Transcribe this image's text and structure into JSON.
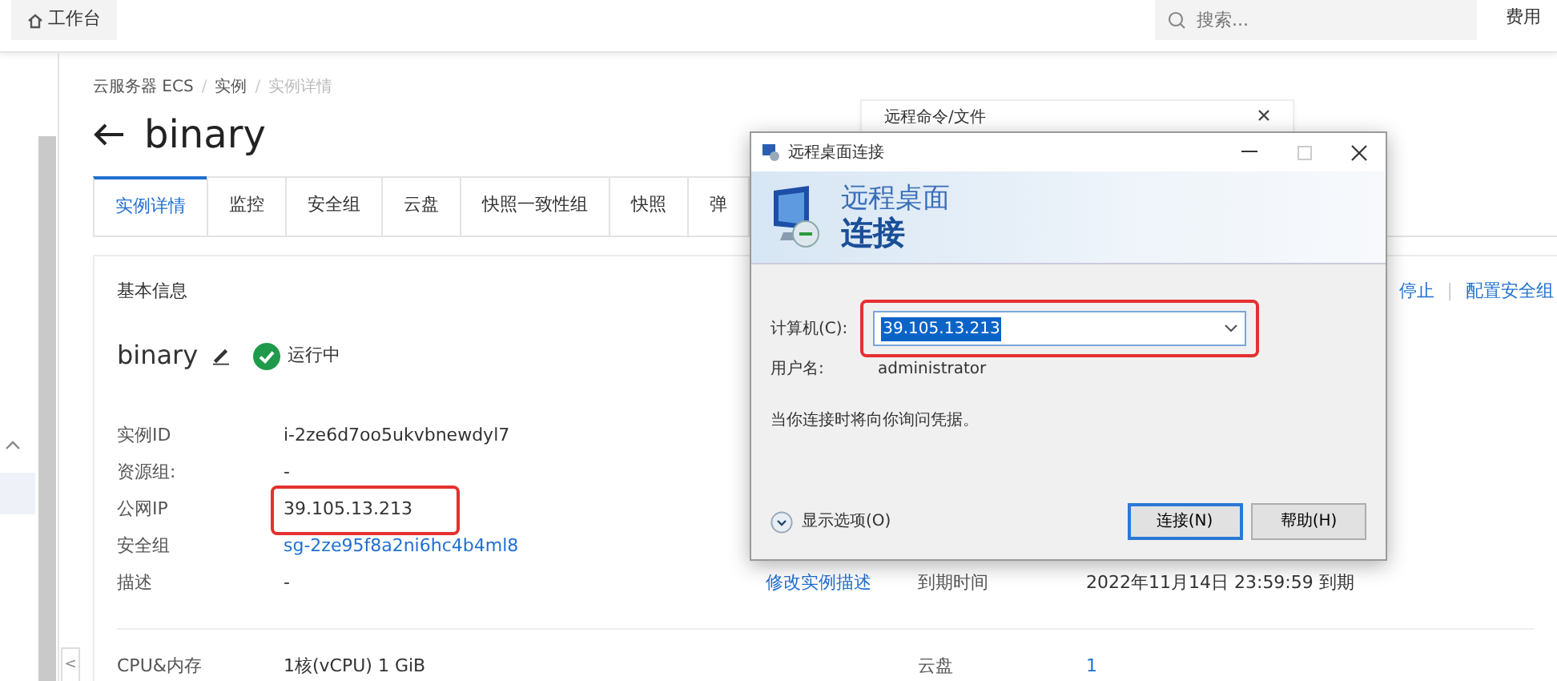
{
  "topbar": {
    "home": "工作台",
    "search": {
      "placeholder": "搜索..."
    },
    "right_link": "费用"
  },
  "breadcrumb": [
    "云服务器 ECS",
    "实例",
    "实例详情"
  ],
  "breadcrumb_separator": "/",
  "collapse_button": "<",
  "page_title": "binary",
  "tabs": [
    {
      "label": "实例详情",
      "selected": true
    },
    {
      "label": "监控",
      "selected": false
    },
    {
      "label": "安全组",
      "selected": false
    },
    {
      "label": "云盘",
      "selected": false
    },
    {
      "label": "快照一致性组",
      "selected": false
    },
    {
      "label": "快照",
      "selected": false
    },
    {
      "label": "弹",
      "selected": false
    }
  ],
  "basic_info": {
    "heading": "基本信息",
    "actions": [
      "停止",
      "配置安全组"
    ],
    "actions_separator": "|",
    "name": "binary",
    "status": "运行中",
    "rows": [
      {
        "label": "实例ID",
        "value": "i-2ze6d7oo5ukvbnewdyl7",
        "link": false,
        "highlighted": false
      },
      {
        "label": "资源组:",
        "value": "-",
        "link": false,
        "highlighted": false
      },
      {
        "label": "公网IP",
        "value": "39.105.13.213",
        "link": false,
        "highlighted": true
      },
      {
        "label": "安全组",
        "value": "sg-2ze95f8a2ni6hc4b4ml8",
        "link": true,
        "highlighted": false
      },
      {
        "label": "描述",
        "value": "-",
        "link": false,
        "highlighted": false,
        "action": "修改实例描述",
        "label_2": "到期时间",
        "value_2": "2022年11月14日 23:59:59 到期"
      }
    ],
    "next_row": {
      "label": "CPU&内存",
      "value": "1核(vCPU) 1 GiB",
      "label_2": "云盘",
      "value_2": "1"
    }
  },
  "side_panel": {
    "title": "远程命令/文件"
  },
  "dialog": {
    "title": "远程桌面连接",
    "banner_line_1": "远程桌面",
    "banner_line_2": "连接",
    "computer": {
      "label": "计算机(C):",
      "value": "39.105.13.213",
      "highlighted": true
    },
    "user": {
      "label": "用户名:",
      "value": "administrator"
    },
    "note": "当你连接时将向你询问凭据。",
    "options": "显示选项(O)",
    "buttons": [
      {
        "label": "连接(N)",
        "default": true
      },
      {
        "label": "帮助(H)",
        "default": false
      }
    ]
  }
}
